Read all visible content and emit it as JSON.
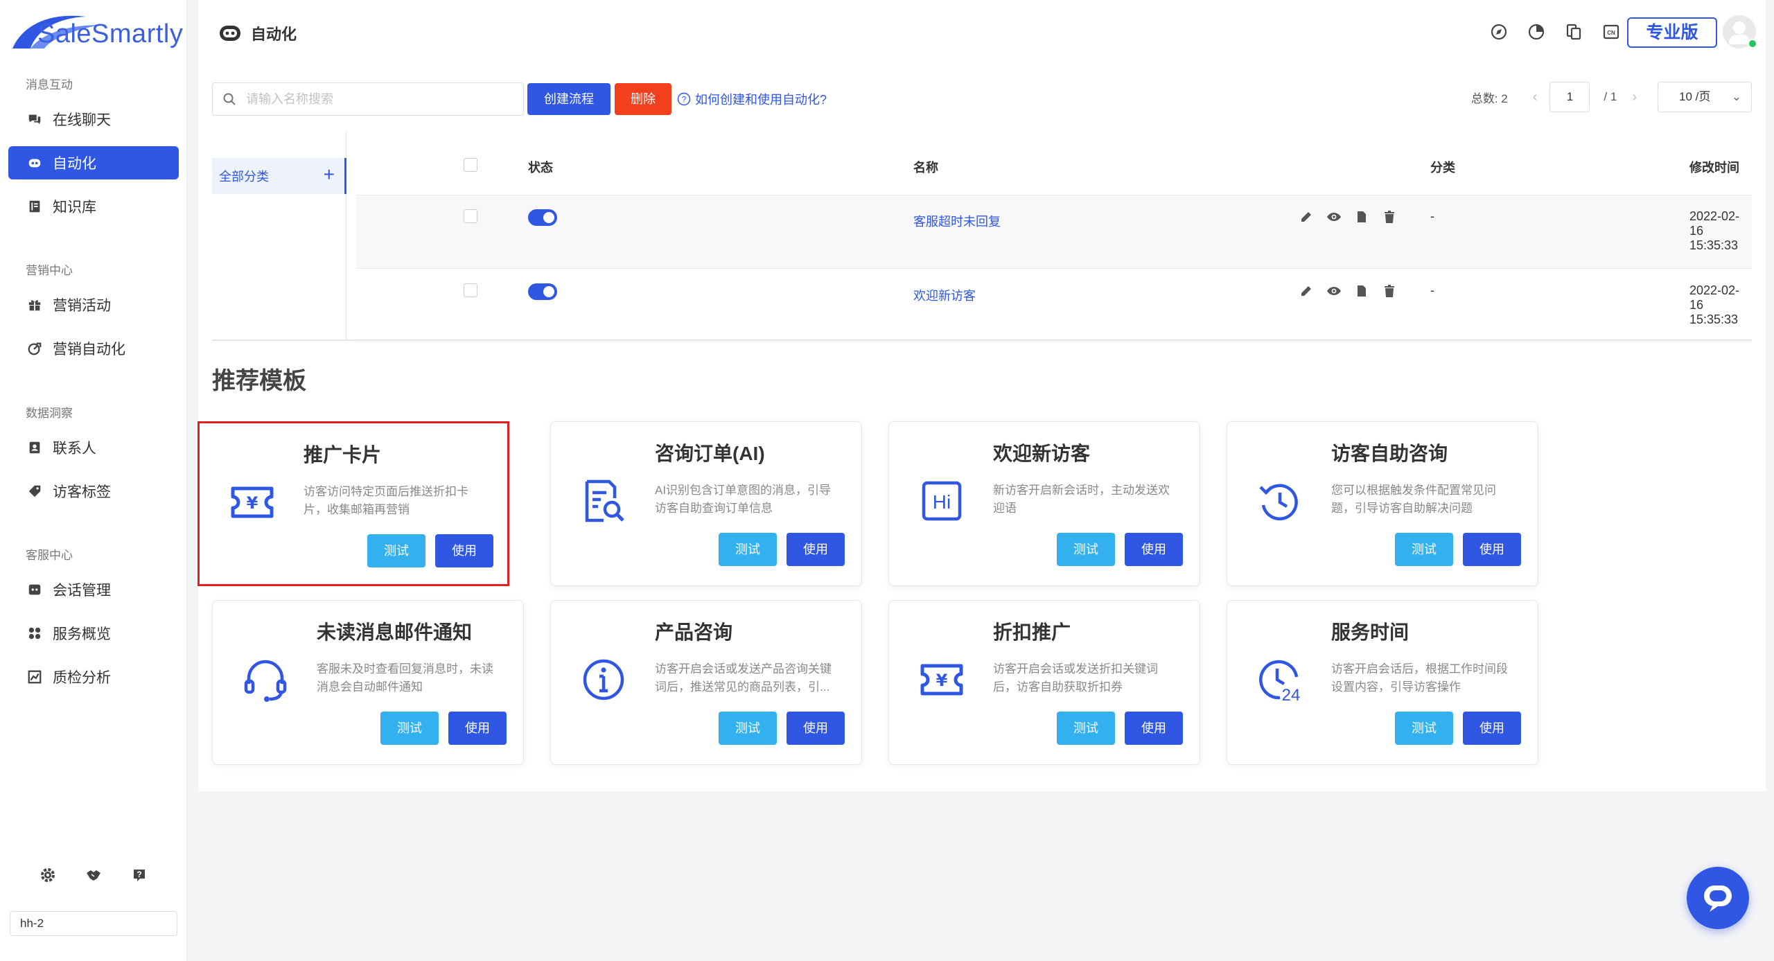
{
  "brand": {
    "name": "SaleSmartly"
  },
  "sidebar": {
    "groups": [
      {
        "title": "消息互动",
        "items": [
          {
            "label": "在线聊天"
          },
          {
            "label": "自动化"
          },
          {
            "label": "知识库"
          }
        ]
      },
      {
        "title": "营销中心",
        "items": [
          {
            "label": "营销活动"
          },
          {
            "label": "营销自动化"
          }
        ]
      },
      {
        "title": "数据洞察",
        "items": [
          {
            "label": "联系人"
          },
          {
            "label": "访客标签"
          }
        ]
      },
      {
        "title": "客服中心",
        "items": [
          {
            "label": "会话管理"
          },
          {
            "label": "服务概览"
          },
          {
            "label": "质检分析"
          }
        ]
      }
    ],
    "active_item": "自动化",
    "workspace": "hh-2",
    "bottom_icons": [
      "gear-icon",
      "handshake-icon",
      "help-icon"
    ]
  },
  "header": {
    "title": "自动化",
    "plan_button": "专业版",
    "tool_icons": [
      "compass-icon",
      "pie-chart-icon",
      "copy-icon",
      "language-icon"
    ]
  },
  "toolbar": {
    "search_placeholder": "请输入名称搜索",
    "create_label": "创建流程",
    "delete_label": "删除",
    "help_label": "如何创建和使用自动化?"
  },
  "pager": {
    "total_label": "总数: 2",
    "current_page": "1",
    "page_count": "/ 1",
    "page_size": "10 /页"
  },
  "categories": {
    "all_label": "全部分类",
    "add_symbol": "+"
  },
  "table": {
    "columns": {
      "status": "状态",
      "name": "名称",
      "category": "分类",
      "modified": "修改时间"
    },
    "rows": [
      {
        "enabled": true,
        "name": "客服超时未回复",
        "category": "-",
        "modified": "2022-02-16 15:35:33"
      },
      {
        "enabled": true,
        "name": "欢迎新访客",
        "category": "-",
        "modified": "2022-02-16 15:35:33"
      }
    ]
  },
  "templates": {
    "section_title": "推荐模板",
    "test_label": "测试",
    "use_label": "使用",
    "items": [
      {
        "title": "推广卡片",
        "desc": "访客访问特定页面后推送折扣卡片，收集邮箱再营销",
        "icon": "coupon-icon",
        "highlighted": true
      },
      {
        "title": "咨询订单(AI)",
        "desc": "AI识别包含订单意图的消息，引导访客自助查询订单信息",
        "icon": "order-search-icon",
        "highlighted": false
      },
      {
        "title": "欢迎新访客",
        "desc": "新访客开启新会话时，主动发送欢迎语",
        "icon": "hi-icon",
        "highlighted": false
      },
      {
        "title": "访客自助咨询",
        "desc": "您可以根据触发条件配置常见问题，引导访客自助解决问题",
        "icon": "clock-rewind-icon",
        "highlighted": false
      },
      {
        "title": "未读消息邮件通知",
        "desc": "客服未及时查看回复消息时，未读消息会自动邮件通知",
        "icon": "headset-icon",
        "highlighted": false
      },
      {
        "title": "产品咨询",
        "desc": "访客开启会话或发送产品咨询关键词后，推送常见的商品列表，引...",
        "icon": "info-icon",
        "highlighted": false
      },
      {
        "title": "折扣推广",
        "desc": "访客开启会话或发送折扣关键词后，访客自助获取折扣券",
        "icon": "coupon-icon",
        "highlighted": false
      },
      {
        "title": "服务时间",
        "desc": "访客开启会话后，根据工作时间段设置内容，引导访客操作",
        "icon": "clock-24-icon",
        "highlighted": false
      }
    ]
  },
  "colors": {
    "primary": "#2f57e3",
    "test_button": "#33b0ee",
    "delete_button": "#f2401d",
    "highlight_border": "#e3201f"
  }
}
